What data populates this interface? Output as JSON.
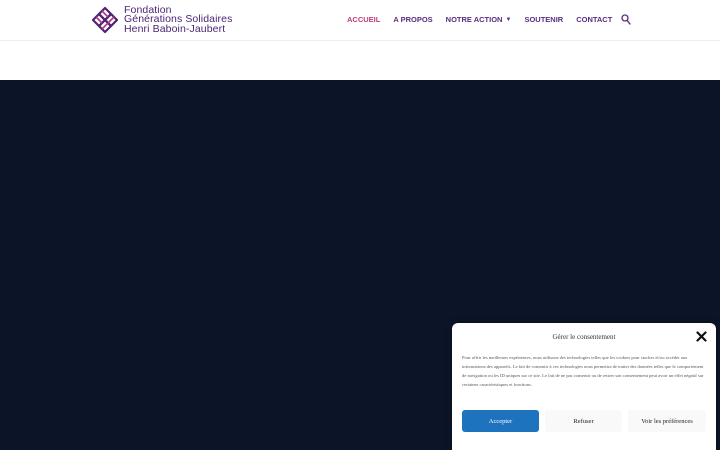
{
  "brand": {
    "line1": "Fondation",
    "line2": "Générations Solidaires",
    "line3": "Henri Baboin-Jaubert",
    "color": "#4b2574"
  },
  "nav": {
    "items": [
      {
        "label": "ACCUEIL",
        "active": true
      },
      {
        "label": "A PROPOS"
      },
      {
        "label": "NOTRE ACTION",
        "has_dropdown": true
      },
      {
        "label": "SOUTENIR"
      },
      {
        "label": "CONTACT"
      }
    ],
    "active_color": "#c23a7e",
    "color": "#5a2d82",
    "search_icon": "search-icon"
  },
  "hero": {
    "background": "#0c1527"
  },
  "consent": {
    "title": "Gérer le consentement",
    "body": "Pour offrir les meilleures expériences, nous utilisons des technologies telles que les cookies pour stocker et/ou accéder aux informations des appareils. Le fait de consentir à ces technologies nous permettra de traiter des données telles que le comportement de navigation ou les ID uniques sur ce site. Le fait de ne pas consentir ou de retirer son consentement peut avoir un effet négatif sur certaines caractéristiques et fonctions.",
    "accept_label": "Accepter",
    "refuse_label": "Refuser",
    "prefs_label": "Voir les préférences",
    "accent": "#1e73be",
    "close_icon": "close-icon"
  }
}
